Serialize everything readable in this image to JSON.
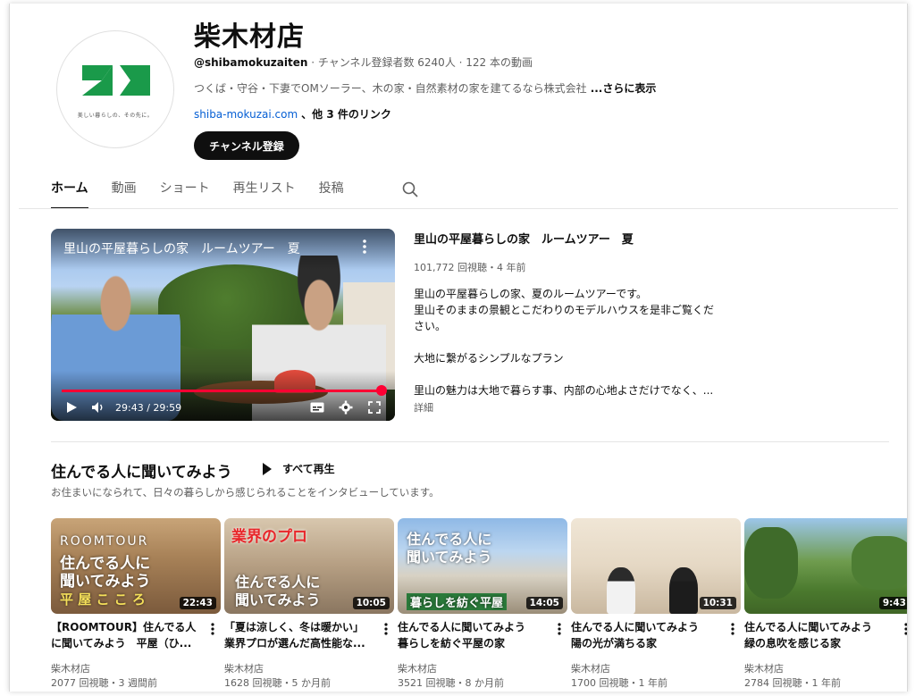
{
  "channel": {
    "name": "柴木材店",
    "logo_tagline": "美しい暮らしの、その先に。",
    "handle": "@shibamokuzaiten",
    "meta": " · チャンネル登録者数 6240人 · 122 本の動画",
    "description": "つくば・守谷・下妻でOMソーラー、木の家・自然素材の家を建てるなら株式会社",
    "more_label": "...さらに表示",
    "link": "shiba-mokuzai.com",
    "other_links": "、他 3 件のリンク",
    "subscribe_label": "チャンネル登録",
    "brand_color": "#1a9a4a"
  },
  "tabs": [
    {
      "label": "ホーム",
      "active": true
    },
    {
      "label": "動画"
    },
    {
      "label": "ショート"
    },
    {
      "label": "再生リスト"
    },
    {
      "label": "投稿"
    }
  ],
  "featured": {
    "overlay_title": "里山の平屋暮らしの家　ルームツアー　夏",
    "title": "里山の平屋暮らしの家　ルームツアー　夏",
    "meta": "101,772 回視聴・4 年前",
    "time": "29:43 / 29:59",
    "progress": 0.991,
    "desc_lines": [
      "里山の平屋暮らしの家、夏のルームツアーです。",
      "里山そのままの景観とこだわりのモデルハウスを是非ご覧くだ",
      "さい。",
      "",
      "大地に繋がるシンプルなプラン",
      "",
      "里山の魅力は大地で暮らす事、内部の心地よさだけでなく、..."
    ],
    "more_label": "詳細",
    "progress_color": "#ff0033"
  },
  "shelf": {
    "title": "住んでる人に聞いてみよう",
    "play_all": "すべて再生",
    "subtitle": "お住まいになられて、日々の暮らしから感じられることをインタビューしています。",
    "videos": [
      {
        "duration": "22:43",
        "title_lines": [
          "【ROOMTOUR】住んでる人",
          "に聞いてみよう　平屋（ひ..."
        ],
        "channel": "柴木材店",
        "stats": "2077 回視聴・3 週間前",
        "caps": [
          "ROOMTOUR",
          "住んでる人に",
          "聞いてみよう",
          "平 屋 こ こ ろ"
        ]
      },
      {
        "duration": "10:05",
        "title_lines": [
          "「夏は涼しく、冬は暖かい」",
          "業界プロが選んだ高性能な..."
        ],
        "channel": "柴木材店",
        "stats": "1628 回視聴・5 か月前",
        "caps": [
          "業界のプロ",
          "住んでる人に",
          "聞いてみよう"
        ]
      },
      {
        "duration": "14:05",
        "title_lines": [
          "住んでる人に聞いてみよう",
          "暮らしを紡ぐ平屋の家"
        ],
        "channel": "柴木材店",
        "stats": "3521 回視聴・8 か月前",
        "caps": [
          "住んでる人に",
          "聞いてみよう",
          "暮らしを紡ぐ平屋"
        ]
      },
      {
        "duration": "10:31",
        "title_lines": [
          "住んでる人に聞いてみよう",
          "陽の光が満ちる家"
        ],
        "channel": "柴木材店",
        "stats": "1700 回視聴・1 年前",
        "caps": []
      },
      {
        "duration": "9:43",
        "title_lines": [
          "住んでる人に聞いてみよう",
          "緑の息吹を感じる家"
        ],
        "channel": "柴木材店",
        "stats": "2784 回視聴・1 年前",
        "caps": []
      }
    ]
  }
}
